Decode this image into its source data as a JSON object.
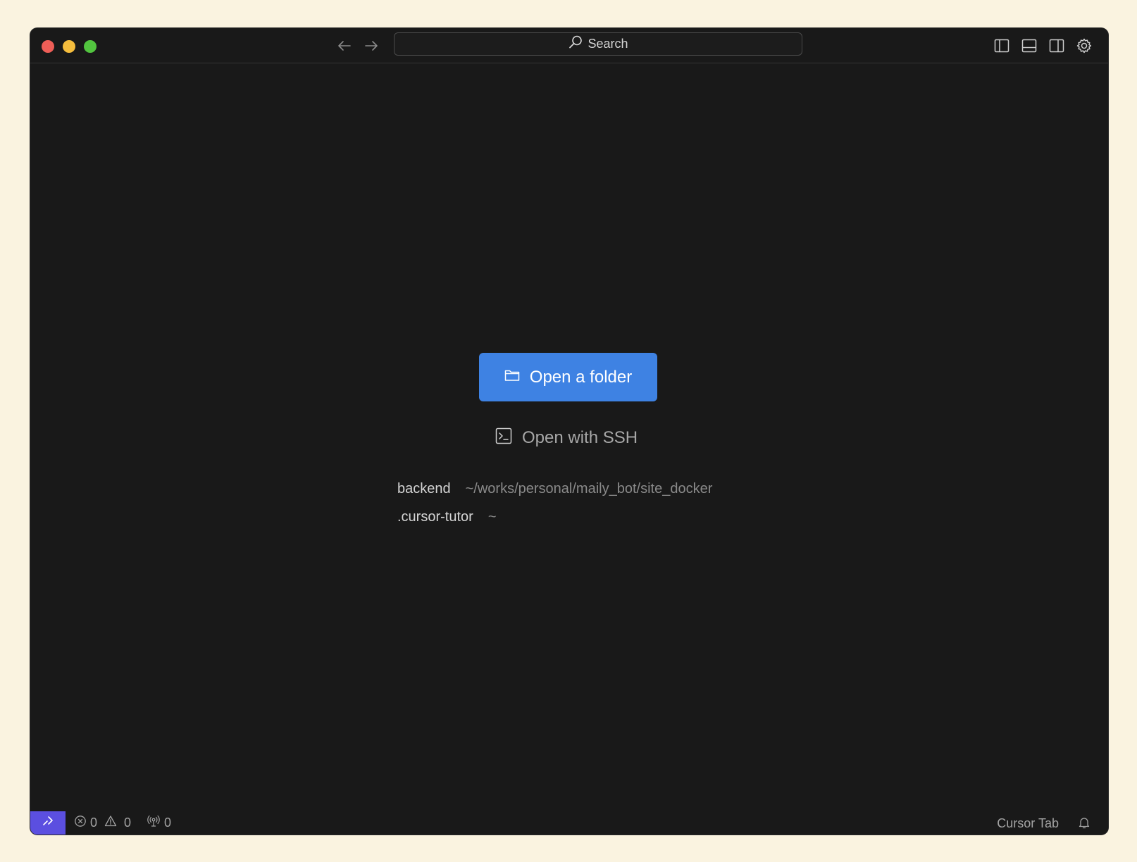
{
  "titlebar": {
    "search_label": "Search",
    "icons": [
      "back-arrow-icon",
      "forward-arrow-icon",
      "search-icon",
      "toggle-primary-sidebar-icon",
      "toggle-panel-icon",
      "toggle-secondary-sidebar-icon",
      "settings-gear-icon"
    ]
  },
  "main": {
    "open_folder_label": "Open a folder",
    "open_ssh_label": "Open with SSH",
    "recent": [
      {
        "name": "backend",
        "path": "~/works/personal/maily_bot/site_docker"
      },
      {
        "name": ".cursor-tutor",
        "path": "~"
      }
    ]
  },
  "statusbar": {
    "errors": "0",
    "warnings": "0",
    "ports": "0",
    "cursor_tab_label": "Cursor Tab"
  },
  "colors": {
    "window_bg": "#191919",
    "primary_button": "#3e82e3",
    "remote_indicator": "#5b4fe0",
    "page_bg": "#faf3e0"
  }
}
